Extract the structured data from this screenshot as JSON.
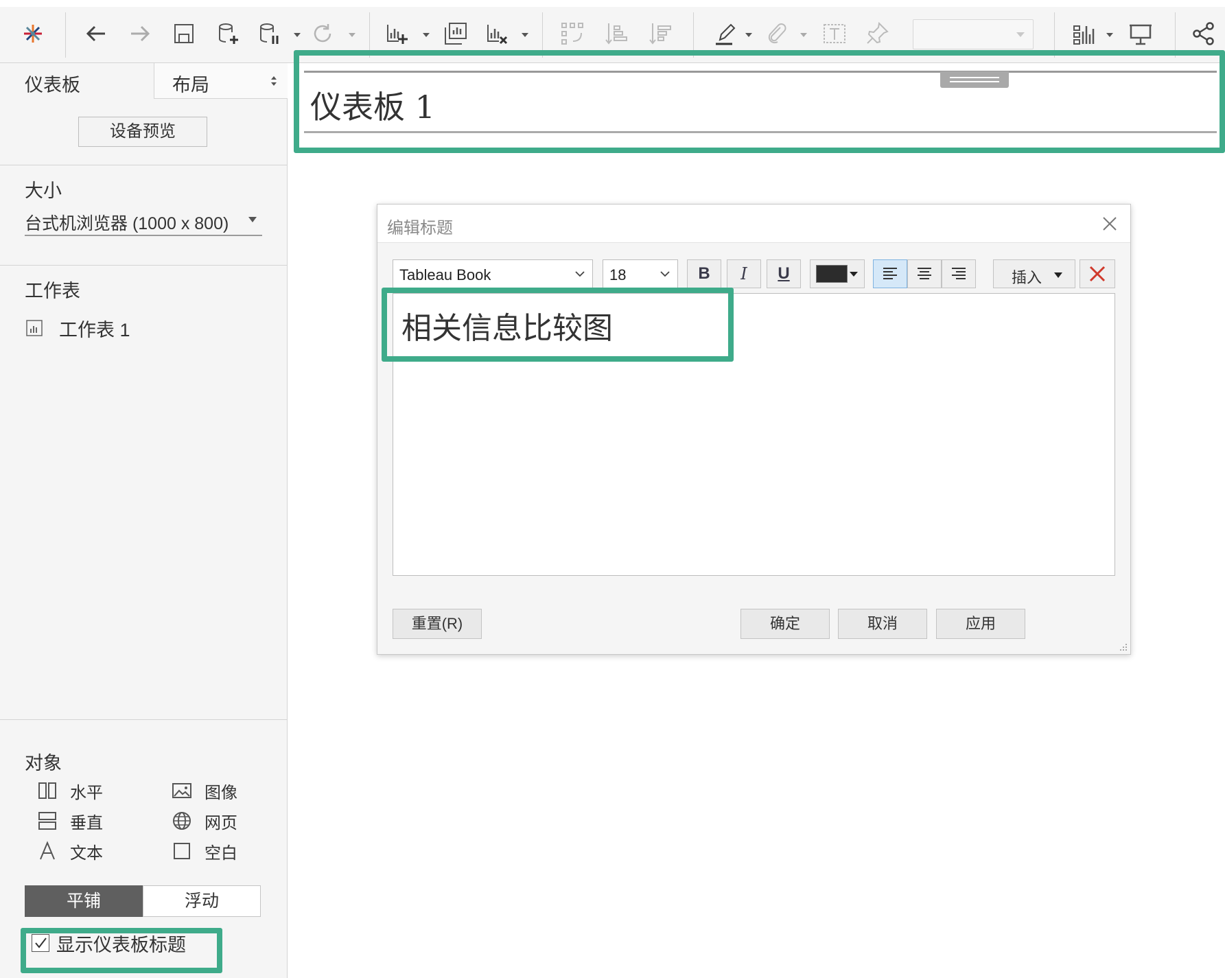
{
  "toolbar": {
    "icons": [
      "tableau-logo-icon",
      "back-icon",
      "forward-icon",
      "save-icon",
      "new-datasource-icon",
      "pause-autoupdate-icon",
      "refresh-icon",
      "new-worksheet-icon",
      "duplicate-sheet-icon",
      "clear-sheet-icon",
      "swap-icon",
      "sort-asc-icon",
      "sort-desc-icon",
      "highlight-icon",
      "group-icon",
      "labels-icon",
      "pin-icon",
      "show-me-icon",
      "presentation-icon",
      "share-icon"
    ],
    "fit_combo_value": ""
  },
  "left_panel": {
    "tab_dashboard": "仪表板",
    "tab_layout": "布局",
    "device_preview": "设备预览",
    "size_title": "大小",
    "size_value": "台式机浏览器 (1000 x 800)",
    "sheets_title": "工作表",
    "sheets": [
      "工作表 1"
    ],
    "objects_title": "对象",
    "objects": {
      "horizontal": "水平",
      "image": "图像",
      "vertical": "垂直",
      "web_page": "网页",
      "text": "文本",
      "blank": "空白"
    },
    "tiled": "平铺",
    "floating": "浮动",
    "show_title_label": "显示仪表板标题",
    "show_title_checked": true
  },
  "canvas": {
    "dashboard_title": "仪表板 1"
  },
  "dialog": {
    "title": "编辑标题",
    "font_family": "Tableau Book",
    "font_size": "18",
    "bold": "B",
    "italic": "I",
    "underline": "U",
    "text_color": "#2c2c2c",
    "insert_label": "插入",
    "editor_text": "相关信息比较图",
    "reset": "重置(R)",
    "ok": "确定",
    "cancel": "取消",
    "apply": "应用"
  },
  "colors": {
    "highlight": "#3fab8a",
    "align_active": "#d5e8f8"
  }
}
